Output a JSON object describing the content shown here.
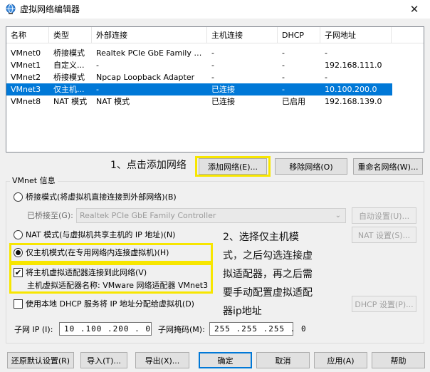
{
  "window": {
    "title": "虚拟网络编辑器",
    "close_glyph": "✕",
    "icon": "globe-network-icon"
  },
  "network_list": {
    "columns": [
      "名称",
      "类型",
      "外部连接",
      "主机连接",
      "DHCP",
      "子网地址"
    ],
    "rows": [
      {
        "name": "VMnet0",
        "type": "桥接模式",
        "external": "Realtek PCIe GbE Family Co...",
        "host": "-",
        "dhcp": "-",
        "subnet": "-"
      },
      {
        "name": "VMnet1",
        "type": "自定义...",
        "external": "-",
        "host": "-",
        "dhcp": "-",
        "subnet": "192.168.111.0"
      },
      {
        "name": "VMnet2",
        "type": "桥接模式",
        "external": "Npcap Loopback Adapter",
        "host": "-",
        "dhcp": "-",
        "subnet": "-"
      },
      {
        "name": "VMnet3",
        "type": "仅主机...",
        "external": "-",
        "host": "已连接",
        "dhcp": "-",
        "subnet": "10.100.200.0",
        "selected": true
      },
      {
        "name": "VMnet8",
        "type": "NAT 模式",
        "external": "NAT 模式",
        "host": "已连接",
        "dhcp": "已启用",
        "subnet": "192.168.139.0"
      }
    ]
  },
  "annotations": {
    "step1": "1、点击添加网络",
    "step2_lines": [
      "2、选择仅主机模",
      "式，之后勾选连接虚",
      "拟适配器，再之后需",
      "要手动配置虚拟适配",
      "器ip地址"
    ]
  },
  "list_buttons": {
    "add": "添加网络(E)...",
    "remove": "移除网络(O)",
    "rename": "重命名网络(W)..."
  },
  "vmnet_info": {
    "group_title": "VMnet 信息",
    "bridged_label": "桥接模式(将虚拟机直接连接到外部网络)(B)",
    "bridged_to_label": "已桥接至(G):",
    "bridged_to_value": "Realtek PCIe GbE Family Controller",
    "auto_settings": "自动设置(U)...",
    "nat_label": "NAT 模式(与虚拟机共享主机的 IP 地址)(N)",
    "nat_settings": "NAT 设置(S)...",
    "hostonly_label": "仅主机模式(在专用网络内连接虚拟机)(H)",
    "connect_adapter_label": "将主机虚拟适配器连接到此网络(V)",
    "adapter_name_label": "主机虚拟适配器名称: VMware 网络适配器 VMnet3",
    "dhcp_label": "使用本地 DHCP 服务将 IP 地址分配给虚拟机(D)",
    "dhcp_settings": "DHCP 设置(P)...",
    "subnet_ip_label": "子网 IP (I):",
    "subnet_ip_value": "10 .100 .200 . 0",
    "subnet_mask_label": "子网掩码(M):",
    "subnet_mask_value": "255 .255 .255 . 0",
    "selected_mode": "hostonly",
    "connect_adapter_checked": true,
    "dhcp_checked": false
  },
  "footer": {
    "restore": "还原默认设置(R)",
    "import": "导入(T)...",
    "export": "导出(X)...",
    "ok": "确定",
    "cancel": "取消",
    "apply": "应用(A)",
    "help": "帮助"
  },
  "colors": {
    "selection": "#0078d7",
    "highlight_box": "#f7e600"
  }
}
